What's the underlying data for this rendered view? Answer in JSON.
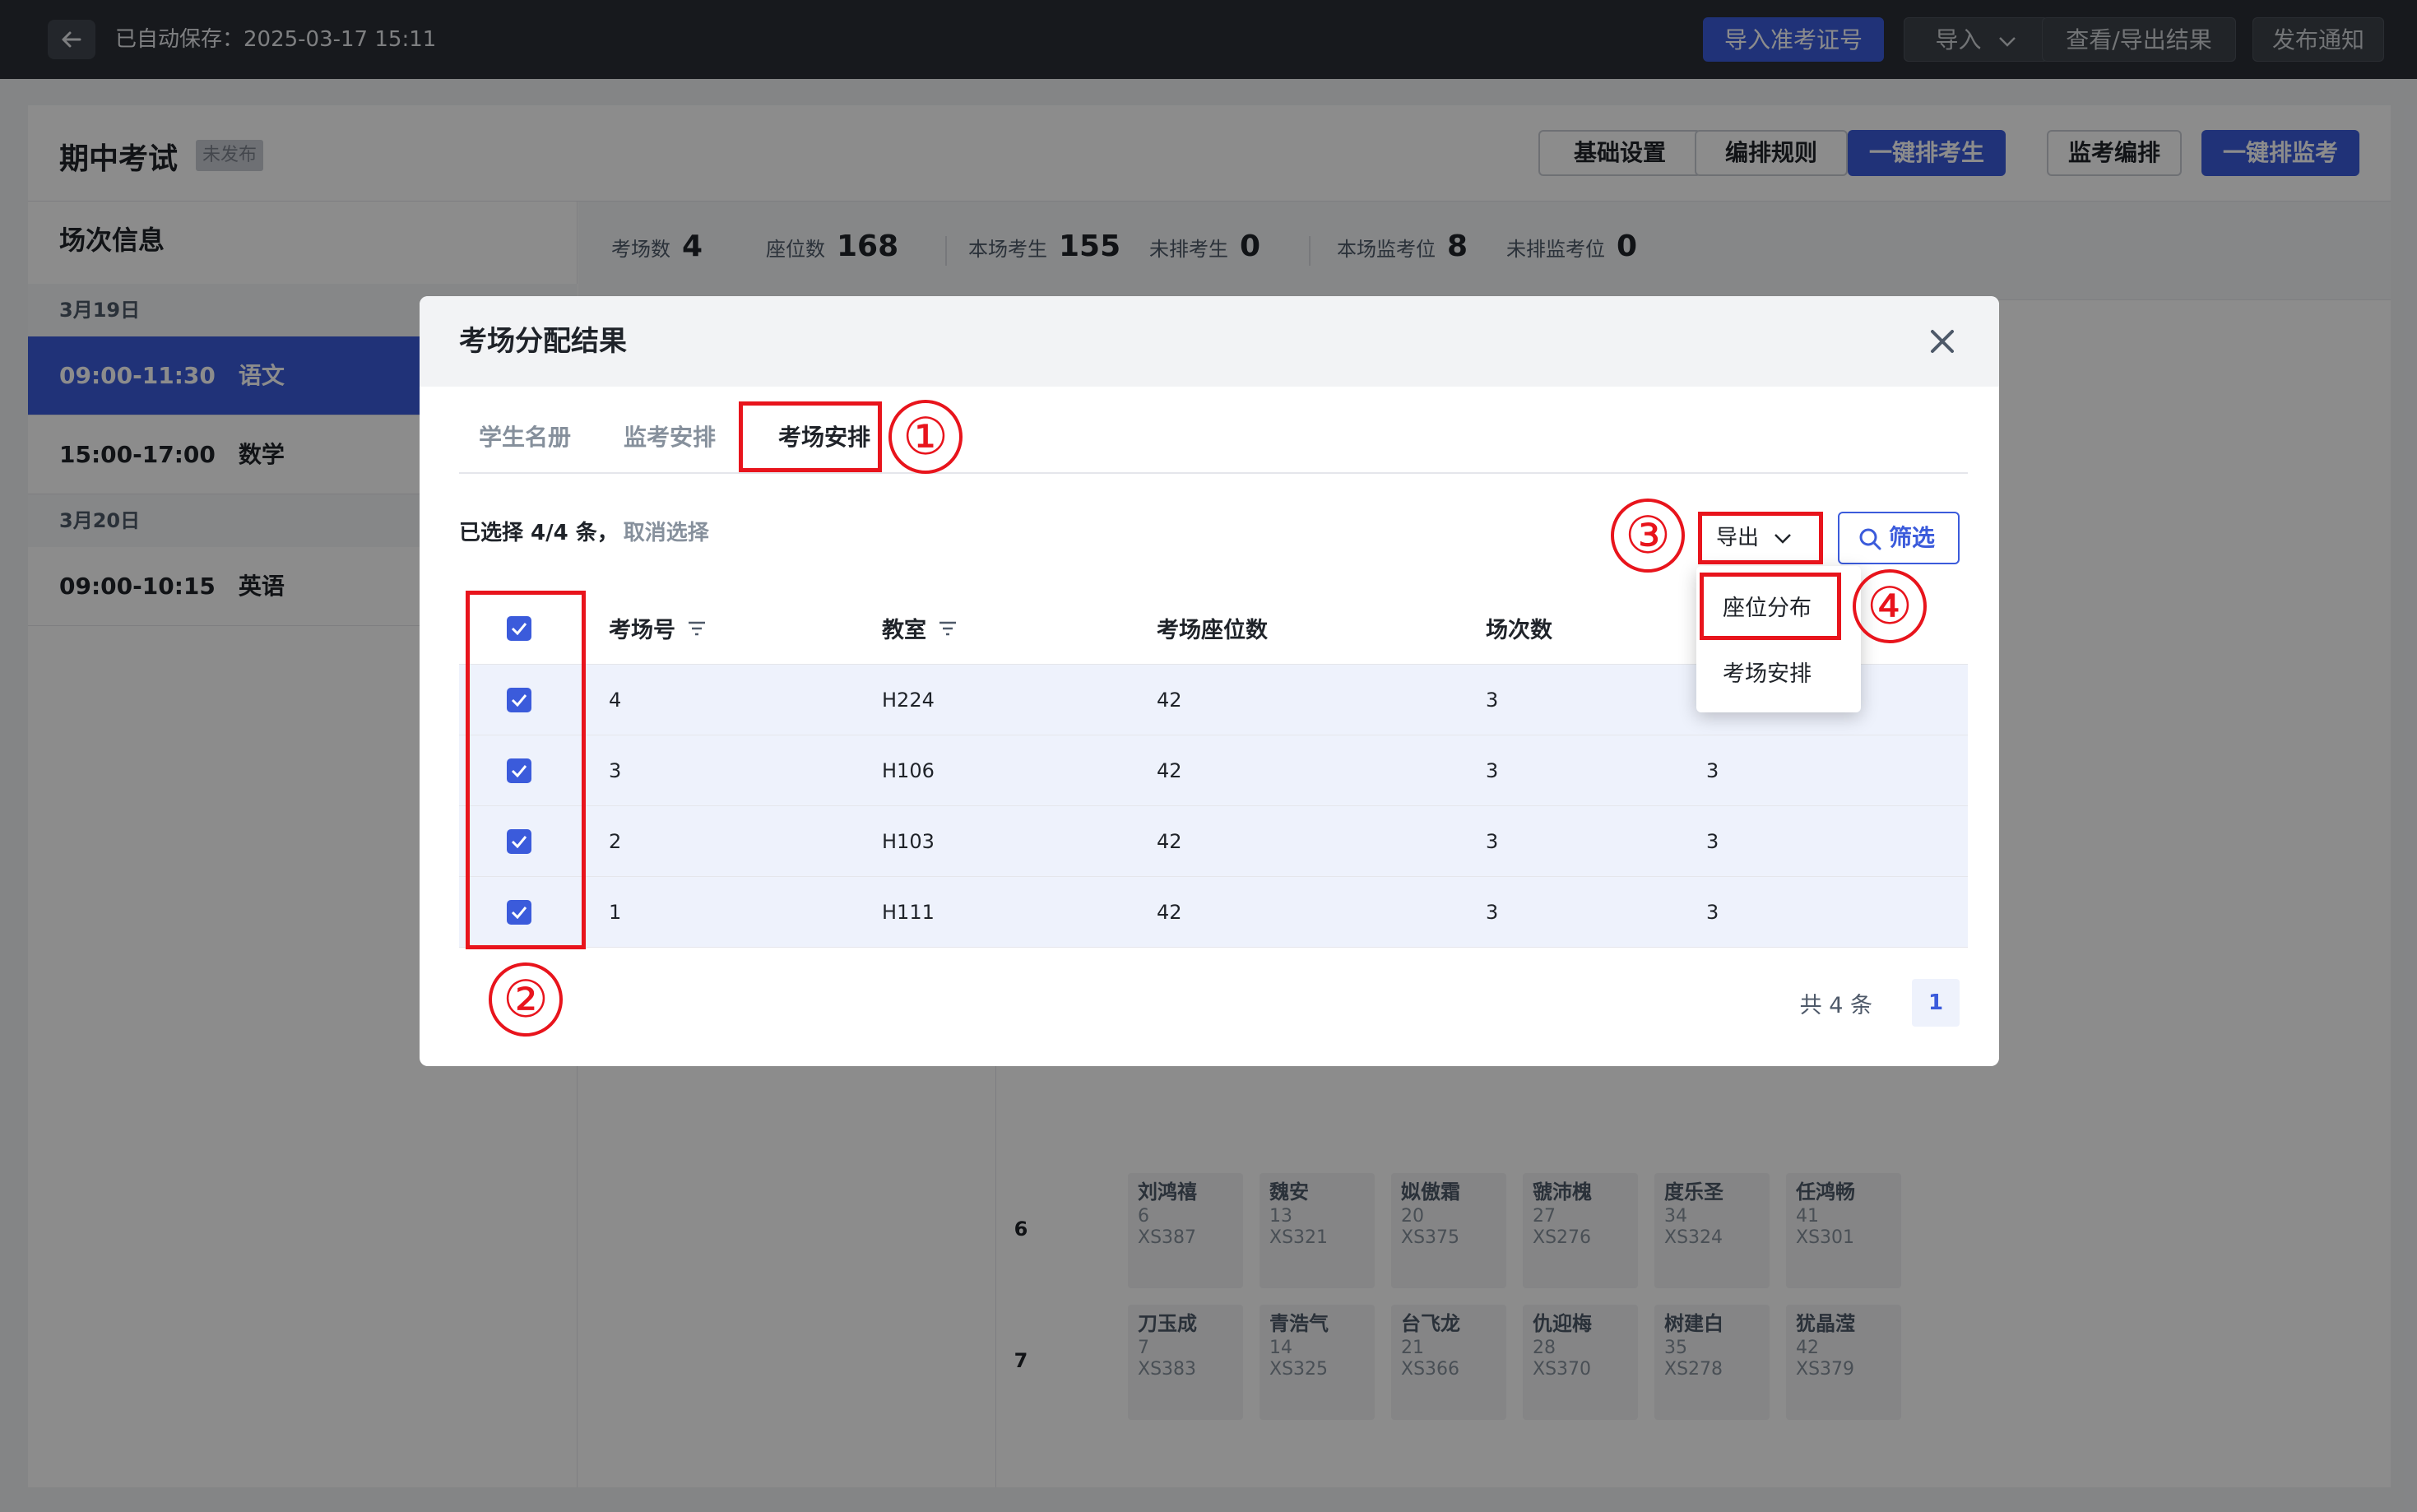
{
  "topbar": {
    "autosave": "已自动保存：2025-03-17 15:11",
    "buttons": {
      "import_ticket": "导入准考证号",
      "import": "导入",
      "view_export": "查看/导出结果",
      "publish": "发布通知"
    }
  },
  "header": {
    "title": "期中考试",
    "status": "未发布",
    "buttons": {
      "basic_settings": "基础设置",
      "rules": "编排规则",
      "auto_students": "一键排考生",
      "invigilation": "监考编排",
      "auto_invigilation": "一键排监考"
    }
  },
  "sidebar": {
    "title": "场次信息",
    "groups": [
      {
        "date": "3月19日",
        "sessions": [
          {
            "time": "09:00-11:30",
            "subject": "语文"
          },
          {
            "time": "15:00-17:00",
            "subject": "数学"
          }
        ]
      },
      {
        "date": "3月20日",
        "sessions": [
          {
            "time": "09:00-10:15",
            "subject": "英语"
          }
        ]
      }
    ]
  },
  "stats": [
    {
      "label": "考场数",
      "value": "4"
    },
    {
      "label": "座位数",
      "value": "168"
    },
    {
      "label": "本场考生",
      "value": "155"
    },
    {
      "label": "未排考生",
      "value": "0"
    },
    {
      "label": "本场监考位",
      "value": "8"
    },
    {
      "label": "未排监考位",
      "value": "0"
    }
  ],
  "seatmap": {
    "rows": [
      {
        "label": "6",
        "seats": [
          {
            "name": "刘鸿禧",
            "no": "6",
            "id": "XS387"
          },
          {
            "name": "魏安",
            "no": "13",
            "id": "XS321"
          },
          {
            "name": "姒傲霜",
            "no": "20",
            "id": "XS375"
          },
          {
            "name": "虢沛槐",
            "no": "27",
            "id": "XS276"
          },
          {
            "name": "度乐圣",
            "no": "34",
            "id": "XS324"
          },
          {
            "name": "任鸿畅",
            "no": "41",
            "id": "XS301"
          }
        ]
      },
      {
        "label": "7",
        "seats": [
          {
            "name": "刀玉成",
            "no": "7",
            "id": "XS383"
          },
          {
            "name": "青浩气",
            "no": "14",
            "id": "XS325"
          },
          {
            "name": "台飞龙",
            "no": "21",
            "id": "XS366"
          },
          {
            "name": "仇迎梅",
            "no": "28",
            "id": "XS370"
          },
          {
            "name": "树建白",
            "no": "35",
            "id": "XS278"
          },
          {
            "name": "犹晶滢",
            "no": "42",
            "id": "XS379"
          }
        ]
      }
    ]
  },
  "modal": {
    "title": "考场分配结果",
    "tabs": [
      "学生名册",
      "监考安排",
      "考场安排"
    ],
    "active_tab": 2,
    "selection": {
      "text": "已选择 4/4 条，",
      "cancel": "取消选择"
    },
    "export_label": "导出",
    "filter_label": "筛选",
    "columns": [
      "考场号",
      "教室",
      "考场座位数",
      "场次数"
    ],
    "rows": [
      {
        "room": "4",
        "classroom": "H224",
        "seats": "42",
        "sessions": "3",
        "extra": ""
      },
      {
        "room": "3",
        "classroom": "H106",
        "seats": "42",
        "sessions": "3",
        "extra": "3"
      },
      {
        "room": "2",
        "classroom": "H103",
        "seats": "42",
        "sessions": "3",
        "extra": "3"
      },
      {
        "room": "1",
        "classroom": "H111",
        "seats": "42",
        "sessions": "3",
        "extra": "3"
      }
    ],
    "pager": {
      "total": "共 4 条",
      "page": "1"
    },
    "dropdown": [
      "座位分布",
      "考场安排"
    ]
  },
  "annotations": [
    "①",
    "②",
    "③",
    "④"
  ],
  "colors": {
    "primary": "#3b5bdb",
    "annotation": "#e8141c",
    "row_selected": "#eef2fc"
  }
}
